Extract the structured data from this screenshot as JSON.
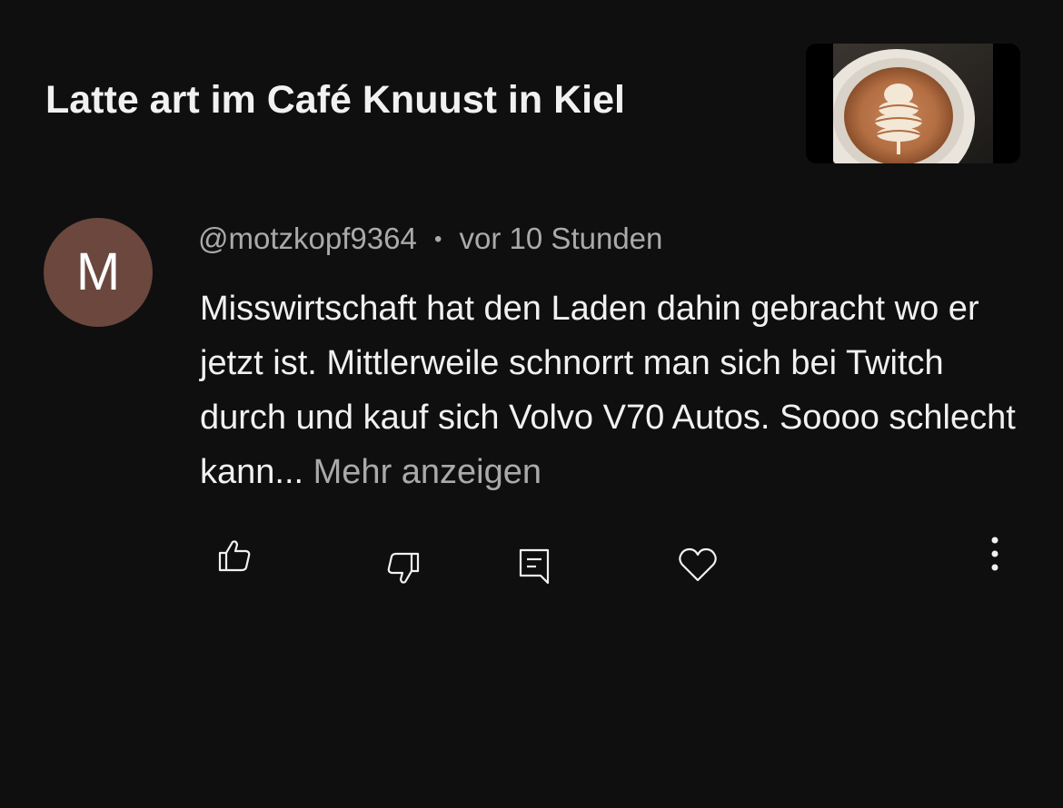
{
  "video": {
    "title": "Latte art im Café Knuust in Kiel"
  },
  "comment": {
    "avatar_letter": "M",
    "author": "@motzkopf9364",
    "separator": "•",
    "time": "vor 10 Stunden",
    "text": "Misswirtschaft hat den Laden dahin gebracht wo er jetzt ist. Mittlerweile schnorrt man sich bei Twitch durch und kauf sich Volvo V70 Autos. Soooo schlecht kann... ",
    "more_label": "Mehr anzeigen"
  },
  "actions": {
    "like_icon": "thumbs-up-icon",
    "dislike_icon": "thumbs-down-icon",
    "reply_icon": "comment-icon",
    "heart_icon": "heart-icon",
    "more_icon": "more-vertical-icon"
  },
  "colors": {
    "background": "#0f0f0f",
    "text_primary": "#f1f1f1",
    "text_secondary": "#aaaaaa",
    "avatar_bg": "#6b473d"
  }
}
